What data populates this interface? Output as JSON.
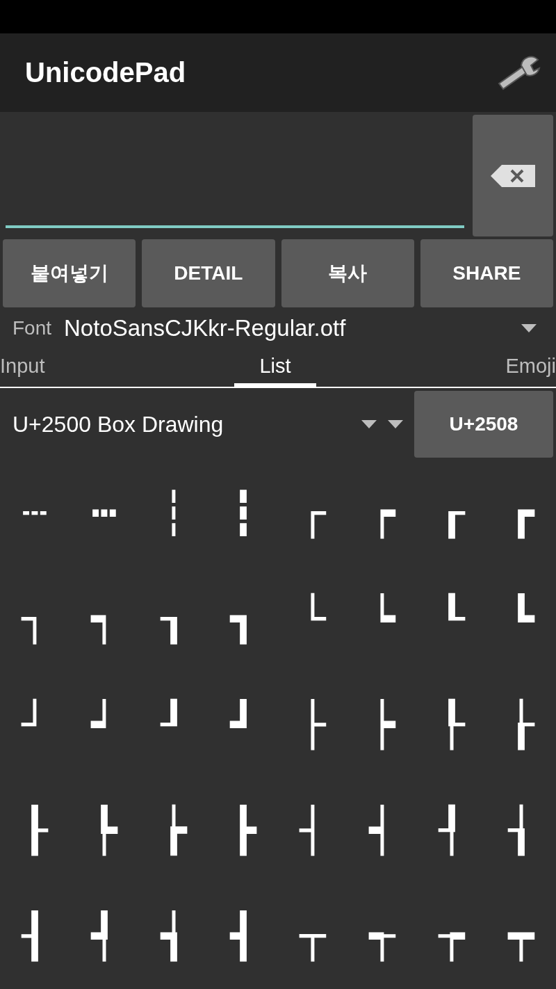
{
  "app_bar": {
    "title": "UnicodePad"
  },
  "buttons": [
    {
      "label": "붙여넣기"
    },
    {
      "label": "DETAIL"
    },
    {
      "label": "복사"
    },
    {
      "label": "SHARE"
    }
  ],
  "font": {
    "label": "Font",
    "value": "NotoSansCJKkr-Regular.otf"
  },
  "tabs": [
    {
      "label": "Input",
      "selected": false
    },
    {
      "label": "List",
      "selected": true
    },
    {
      "label": "Emoji",
      "selected": false
    }
  ],
  "block": {
    "value": "U+2500 Box Drawing",
    "jump": "U+2508"
  },
  "characters": [
    "┄",
    "┅",
    "┆",
    "┇",
    "┌",
    "┍",
    "┎",
    "┏",
    "┐",
    "┑",
    "┒",
    "┓",
    "└",
    "┕",
    "┖",
    "┗",
    "┘",
    "┙",
    "┚",
    "┛",
    "├",
    "┝",
    "┞",
    "┟",
    "┠",
    "┡",
    "┢",
    "┣",
    "┤",
    "┥",
    "┦",
    "┧",
    "┨",
    "┩",
    "┪",
    "┫",
    "┬",
    "┭",
    "┮",
    "┯"
  ]
}
